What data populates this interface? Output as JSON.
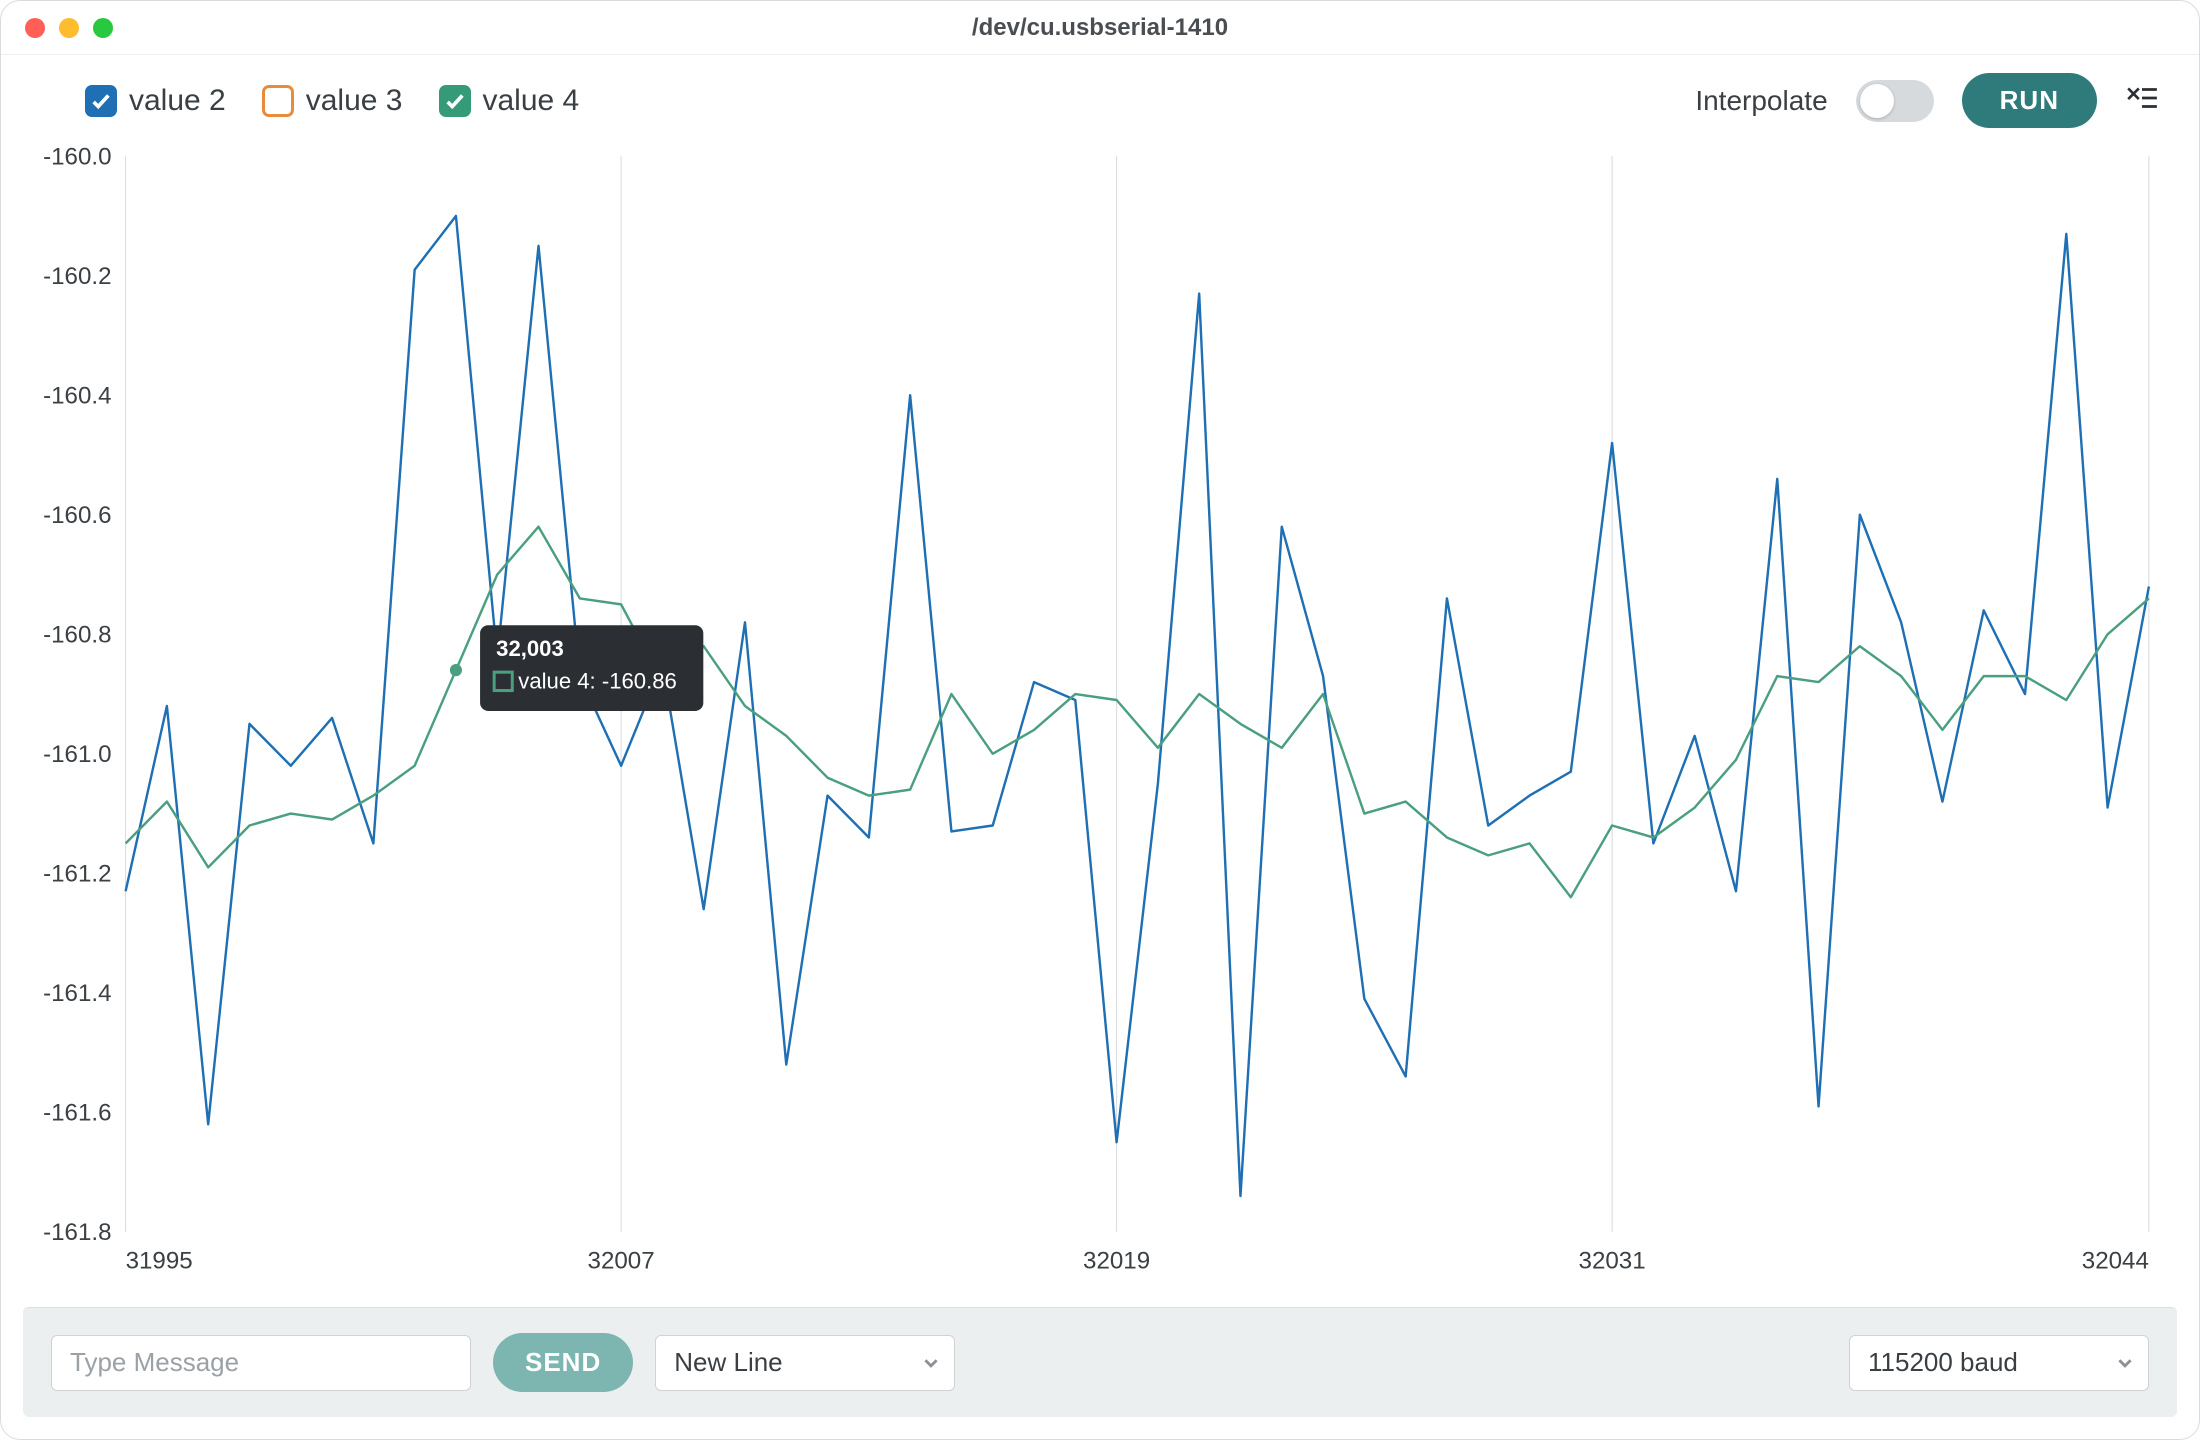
{
  "window": {
    "title": "/dev/cu.usbserial-1410"
  },
  "toolbar": {
    "legend": [
      {
        "label": "value 2",
        "color": "#1e6fb3",
        "checked": true
      },
      {
        "label": "value 3",
        "color": "#e98b3a",
        "checked": false
      },
      {
        "label": "value 4",
        "color": "#359a78",
        "checked": true
      }
    ],
    "interpolate_label": "Interpolate",
    "interpolate_on": false,
    "run_label": "RUN"
  },
  "tooltip": {
    "x_label": "32,003",
    "series_name": "value 4",
    "value": "-160.86"
  },
  "bottombar": {
    "message_placeholder": "Type Message",
    "send_label": "SEND",
    "line_ending_selected": "New Line",
    "baud_selected": "115200 baud"
  },
  "chart_data": {
    "type": "line",
    "xlabel": "",
    "ylabel": "",
    "xlim": [
      31995,
      32044
    ],
    "ylim": [
      -161.8,
      -160.0
    ],
    "x_ticks": [
      31995,
      32007,
      32019,
      32031,
      32044
    ],
    "y_ticks": [
      -160.0,
      -160.2,
      -160.4,
      -160.6,
      -160.8,
      -161.0,
      -161.2,
      -161.4,
      -161.6,
      -161.8
    ],
    "x": [
      31995,
      31996,
      31997,
      31998,
      31999,
      32000,
      32001,
      32002,
      32003,
      32004,
      32005,
      32006,
      32007,
      32008,
      32009,
      32010,
      32011,
      32012,
      32013,
      32014,
      32015,
      32016,
      32017,
      32018,
      32019,
      32020,
      32021,
      32022,
      32023,
      32024,
      32025,
      32026,
      32027,
      32028,
      32029,
      32030,
      32031,
      32032,
      32033,
      32034,
      32035,
      32036,
      32037,
      32038,
      32039,
      32040,
      32041,
      32042,
      32043,
      32044
    ],
    "series": [
      {
        "name": "value 2",
        "color": "#1e6fb3",
        "values": [
          -161.23,
          -160.92,
          -161.62,
          -160.95,
          -161.02,
          -160.94,
          -161.15,
          -160.19,
          -160.1,
          -160.84,
          -160.15,
          -160.87,
          -161.02,
          -160.85,
          -161.26,
          -160.78,
          -161.52,
          -161.07,
          -161.14,
          -160.4,
          -161.13,
          -161.12,
          -160.88,
          -160.91,
          -161.65,
          -161.05,
          -160.23,
          -161.74,
          -160.62,
          -160.87,
          -161.41,
          -161.54,
          -160.74,
          -161.12,
          -161.07,
          -161.03,
          -160.48,
          -161.15,
          -160.97,
          -161.23,
          -160.54,
          -161.59,
          -160.6,
          -160.78,
          -161.08,
          -160.76,
          -160.9,
          -160.13,
          -161.09,
          -160.72
        ]
      },
      {
        "name": "value 4",
        "color": "#4a9f7e",
        "values": [
          -161.15,
          -161.08,
          -161.19,
          -161.12,
          -161.1,
          -161.11,
          -161.07,
          -161.02,
          -160.86,
          -160.7,
          -160.62,
          -160.74,
          -160.75,
          -160.88,
          -160.82,
          -160.92,
          -160.97,
          -161.04,
          -161.07,
          -161.06,
          -160.9,
          -161.0,
          -160.96,
          -160.9,
          -160.91,
          -160.99,
          -160.9,
          -160.95,
          -160.99,
          -160.9,
          -161.1,
          -161.08,
          -161.14,
          -161.17,
          -161.15,
          -161.24,
          -161.12,
          -161.14,
          -161.09,
          -161.01,
          -160.87,
          -160.88,
          -160.82,
          -160.87,
          -160.96,
          -160.87,
          -160.87,
          -160.91,
          -160.8,
          -160.74
        ]
      }
    ]
  }
}
